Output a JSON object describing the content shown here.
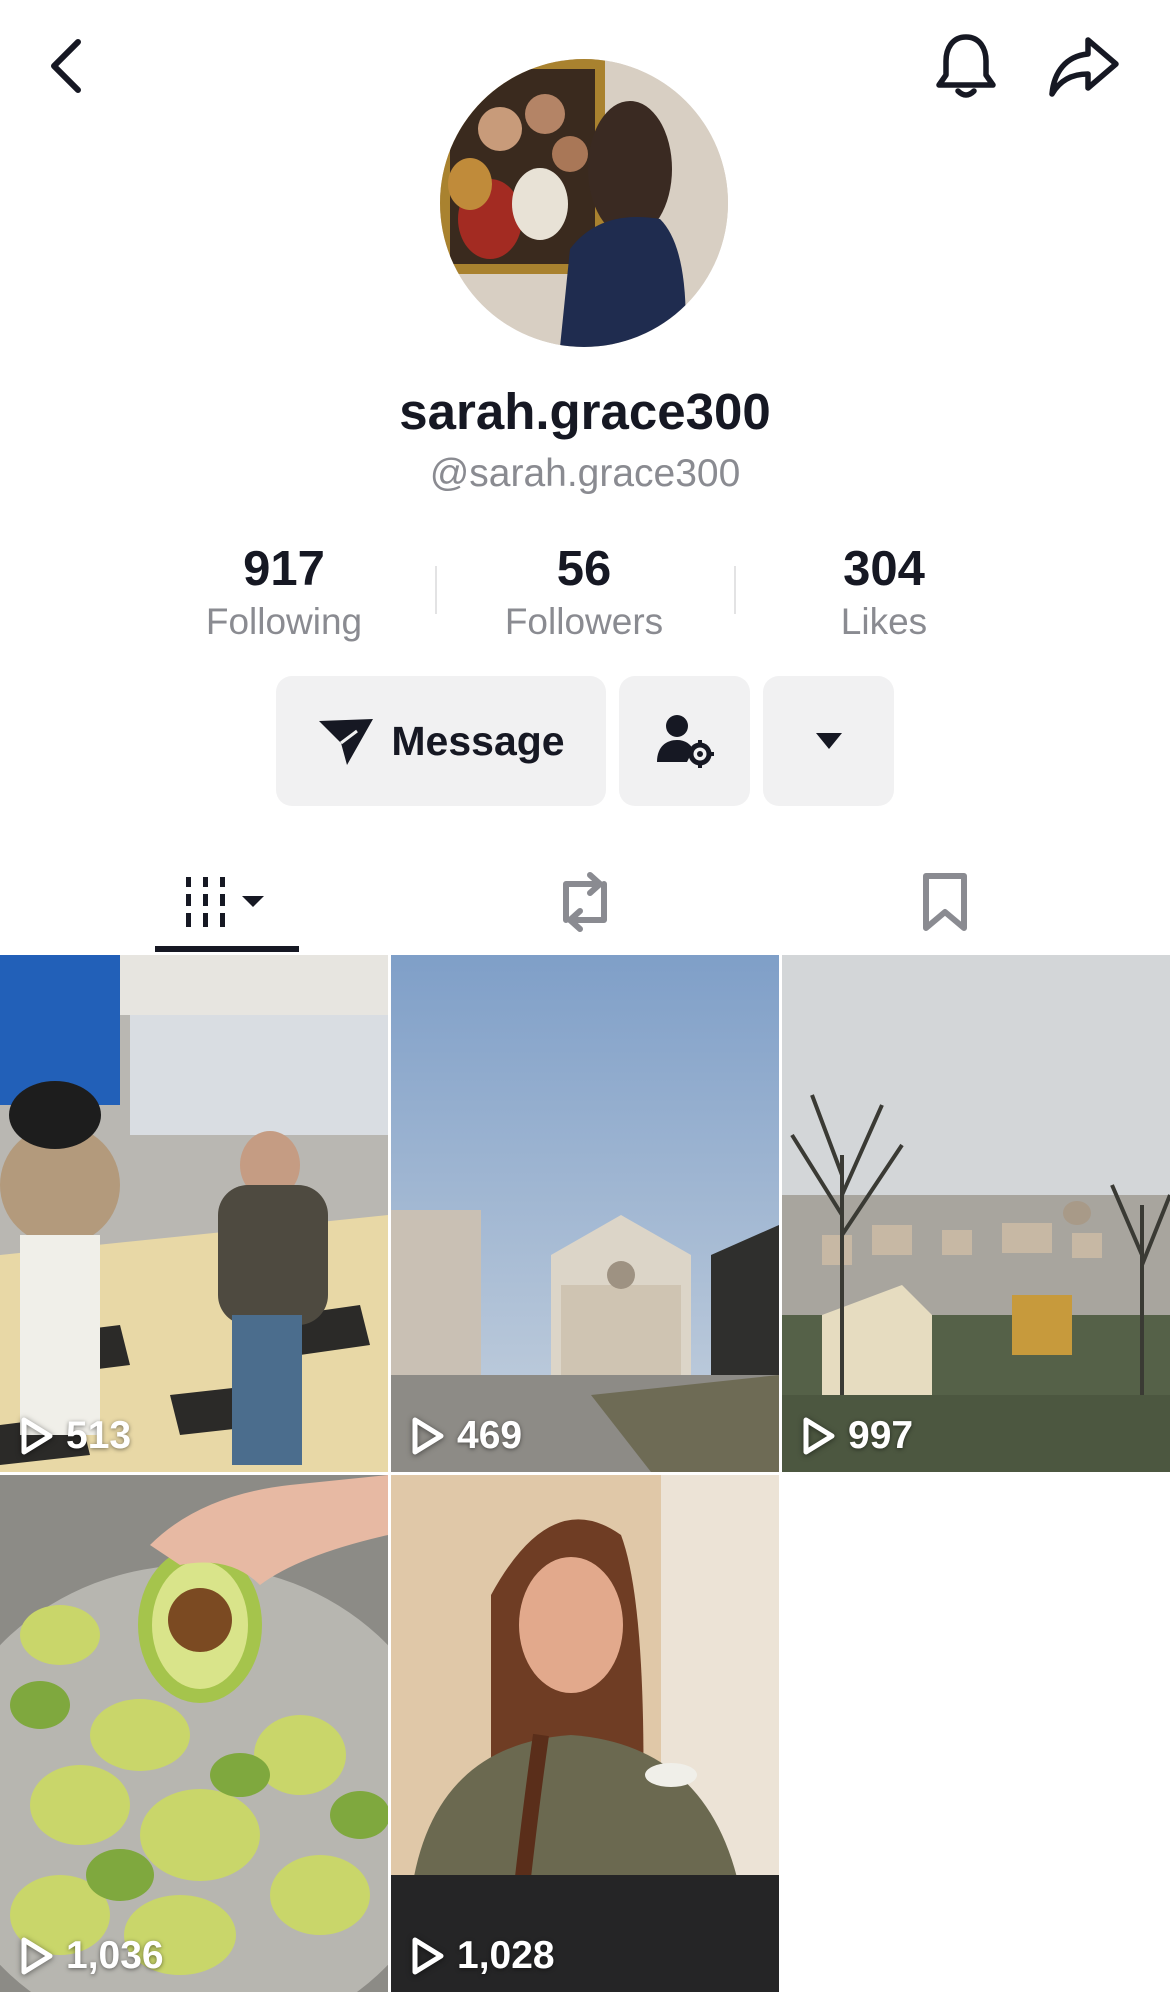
{
  "header": {
    "back_icon": "chevron-left-icon",
    "bell_icon": "bell-icon",
    "share_icon": "share-arrow-icon"
  },
  "profile": {
    "display_name": "sarah.grace300",
    "handle": "@sarah.grace300"
  },
  "stats": [
    {
      "value": "917",
      "label": "Following"
    },
    {
      "value": "56",
      "label": "Followers"
    },
    {
      "value": "304",
      "label": "Likes"
    }
  ],
  "actions": {
    "message_label": "Message",
    "message_icon": "send-icon",
    "friend_icon": "person-gear-icon",
    "more_icon": "caret-down-icon"
  },
  "tabs": [
    {
      "icon": "grid-columns-icon",
      "active": true
    },
    {
      "icon": "repost-icon",
      "active": false
    },
    {
      "icon": "bookmark-icon",
      "active": false
    }
  ],
  "videos": [
    {
      "views": "513"
    },
    {
      "views": "469"
    },
    {
      "views": "997"
    },
    {
      "views": "1,036"
    },
    {
      "views": "1,028"
    }
  ],
  "colors": {
    "text_primary": "#161823",
    "text_secondary": "#8a8b91",
    "button_bg": "#f1f1f2"
  }
}
